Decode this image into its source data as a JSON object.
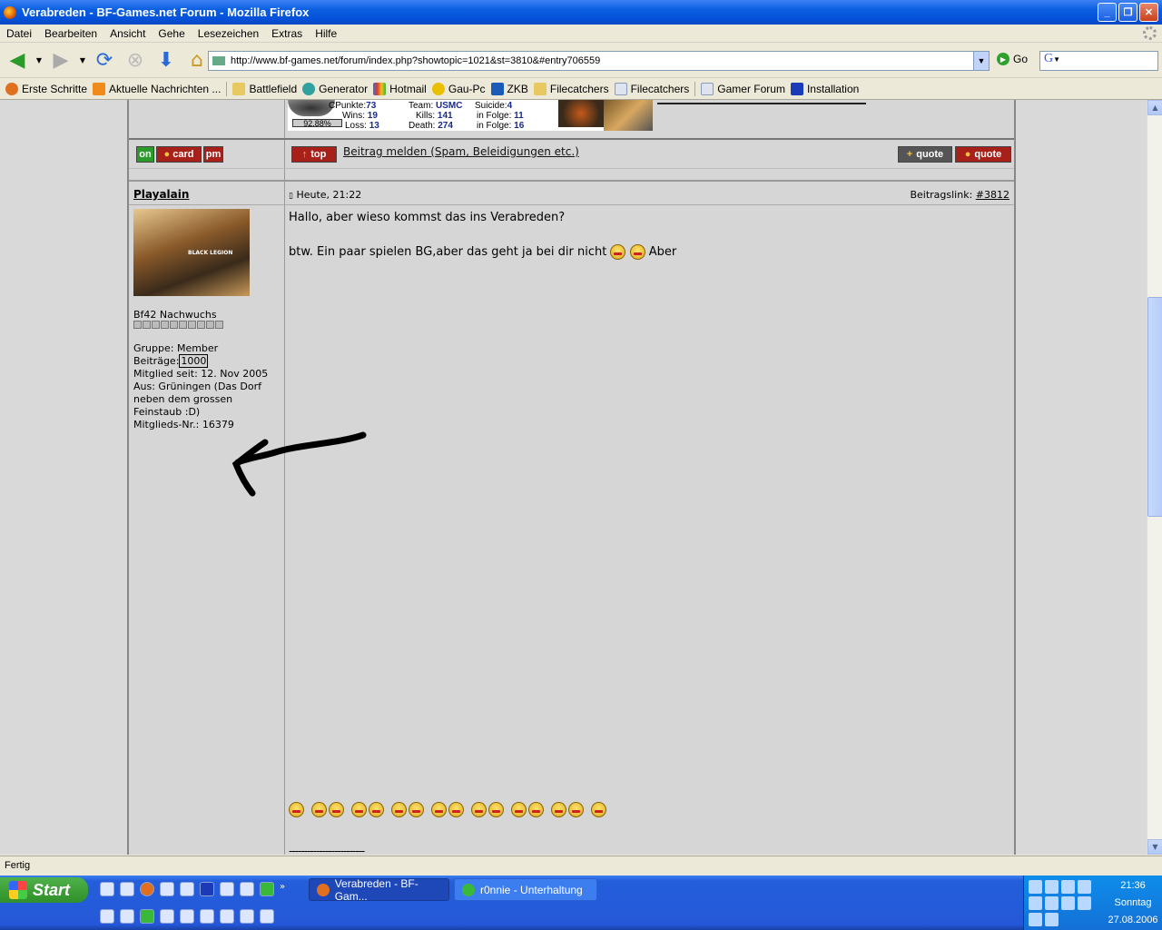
{
  "window": {
    "title": "Verabreden - BF-Games.net Forum - Mozilla Firefox"
  },
  "menu": [
    "Datei",
    "Bearbeiten",
    "Ansicht",
    "Gehe",
    "Lesezeichen",
    "Extras",
    "Hilfe"
  ],
  "nav": {
    "url": "http://www.bf-games.net/forum/index.php?showtopic=1021&st=3810&#entry706559",
    "go_label": "Go"
  },
  "bookmarks": [
    {
      "label": "Erste Schritte",
      "icon": "firefox-icon",
      "color": "#e07020"
    },
    {
      "label": "Aktuelle Nachrichten ...",
      "icon": "rss-icon",
      "color": "#f08a1a"
    },
    {
      "label": "Battlefield",
      "icon": "folder-icon",
      "color": "#e8c860"
    },
    {
      "label": "Generator",
      "icon": "globe-icon",
      "color": "#30a0a0"
    },
    {
      "label": "Hotmail",
      "icon": "msn-butterfly-icon",
      "color": "#3a6ad8"
    },
    {
      "label": "Gau-Pc",
      "icon": "radiation-icon",
      "color": "#e8c000"
    },
    {
      "label": "ZKB",
      "icon": "zkb-icon",
      "color": "#1a5ab8"
    },
    {
      "label": "Filecatchers",
      "icon": "folder-icon",
      "color": "#e8c860"
    },
    {
      "label": "Filecatchers",
      "icon": "page-icon",
      "color": "#dde4f0"
    },
    {
      "label": "Gamer Forum",
      "icon": "page-icon",
      "color": "#dde4f0"
    },
    {
      "label": "Installation",
      "icon": "t-icon",
      "color": "#1a3ab8"
    }
  ],
  "stats": {
    "cpunkte_label": "CPunkte:",
    "cpunkte": "73",
    "wins_label": "Wins:",
    "wins": "19",
    "loss_label": "Loss:",
    "loss": "13",
    "rank_pct": "92.88%",
    "team_label": "Team:",
    "team": "USMC",
    "kills_label": "Kills:",
    "kills": "141",
    "death_label": "Death:",
    "death": "274",
    "suicide_label": "Suicide:",
    "suicide": "4",
    "folge1_label": "in Folge:",
    "folge1": "11",
    "folge2_label": "in Folge:",
    "folge2": "16"
  },
  "buttons": {
    "on": "on",
    "card": "card",
    "pm": "pm",
    "top": "top",
    "quote_add": "quote",
    "quote": "quote"
  },
  "report_link": "Beitrag melden (Spam, Beleidigungen etc.)",
  "post": {
    "author": "Playalain",
    "date": "Heute, 21:22",
    "link_label": "Beitragslink:",
    "link_number": "#3812",
    "avatar_caption": "BLACK LEGION",
    "rank": "Bf42 Nachwuchs",
    "group": "Gruppe: Member",
    "posts_label": "Beiträge:",
    "posts_count": "1000",
    "member_since": "Mitglied seit: 12. Nov 2005",
    "from_1": "Aus: Grüningen (Das Dorf",
    "from_2": "neben dem grossen",
    "from_3": "Feinstaub :D)",
    "member_nr": "Mitglieds-Nr.: 16379",
    "line1": "Hallo, aber wieso kommst das ins Verabreden?",
    "line2": "btw. Ein paar spielen BG,aber das geht ja bei dir nicht",
    "line2_end": "Aber",
    "signature_dashes": "-------------------------"
  },
  "status": "Fertig",
  "taskbar": {
    "start": "Start",
    "task1": "Verabreden - BF-Gam...",
    "task2": "r0nnie - Unterhaltung",
    "time": "21:36",
    "day": "Sonntag",
    "date": "27.08.2006"
  }
}
